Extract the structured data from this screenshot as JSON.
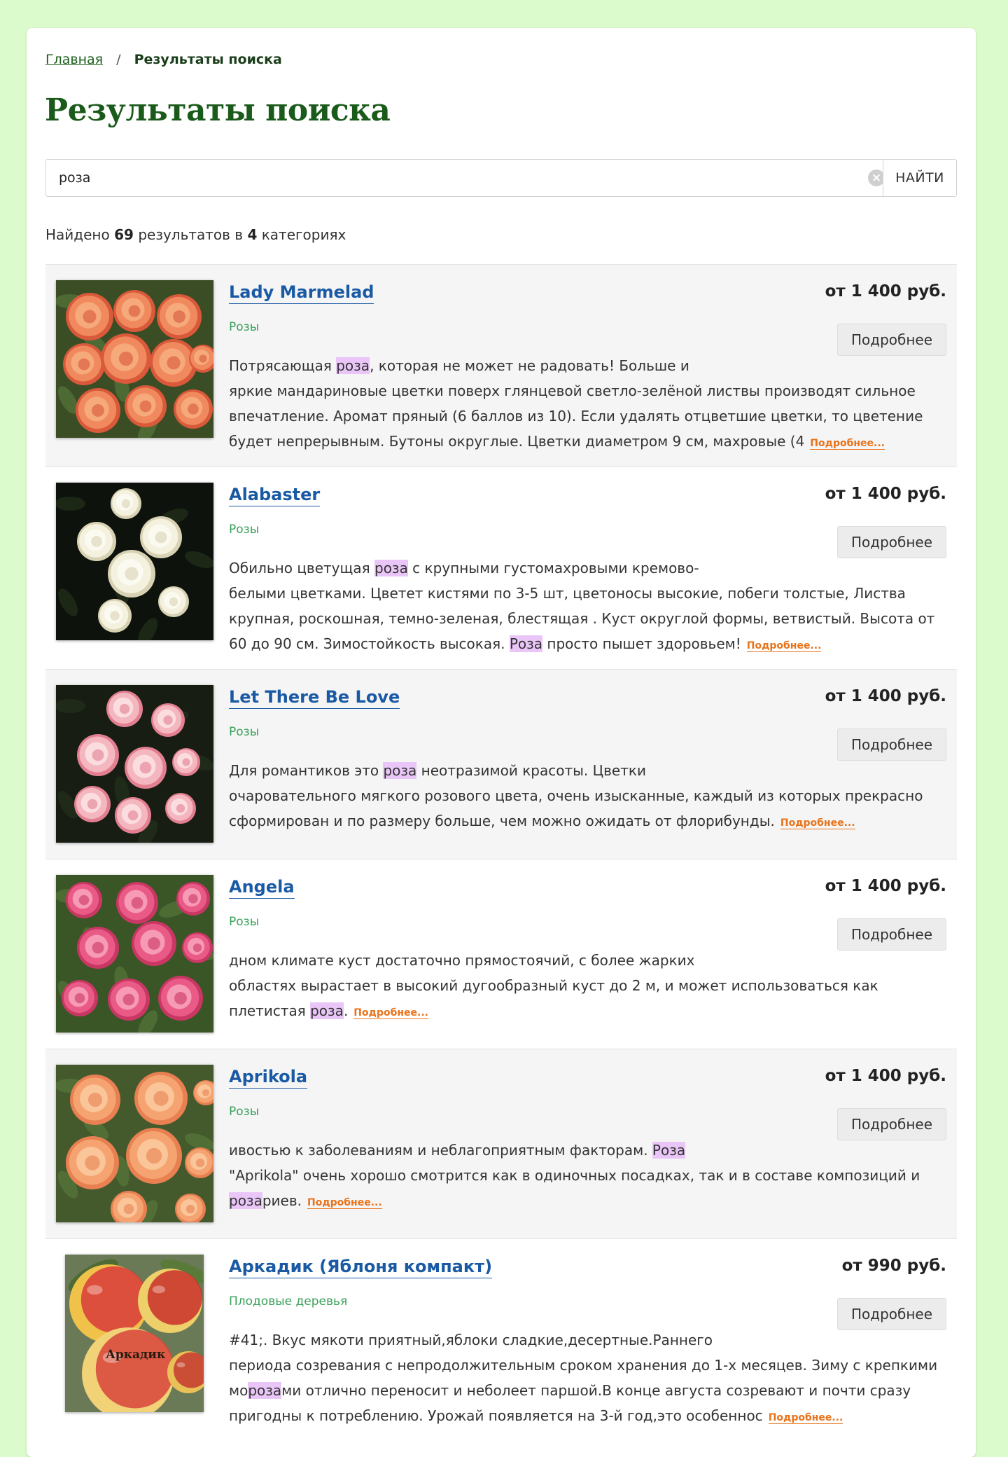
{
  "breadcrumb": {
    "home": "Главная",
    "separator": "/",
    "current": "Результаты поиска"
  },
  "page_title": "Результаты поиска",
  "search": {
    "value": "роза",
    "clear_icon": "×",
    "button": "НАЙТИ"
  },
  "summary": {
    "prefix": "Найдено",
    "count": "69",
    "middle": "результатов в",
    "categories": "4",
    "suffix": "категориях"
  },
  "more_button": "Подробнее",
  "more_link": "Подробнее...",
  "items": [
    {
      "name": "Lady Marmelad",
      "category": "Розы",
      "price": "от 1 400 руб.",
      "desc": [
        {
          "t": "Потрясающая "
        },
        {
          "t": "роза",
          "h": true
        },
        {
          "t": ", которая не может не радовать! Больше и"
        },
        {
          "br": true
        },
        {
          "t": "яркие мандариновые цветки поверх глянцевой светло-зелёной листвы производят сильное впечатление. Аромат пряный (6 баллов из 10). Если удалять отцветшие цветки, то цветение будет непрерывным. Бутоны округлые. Цветки диаметром 9 см, махровые (4"
        }
      ]
    },
    {
      "name": "Alabaster",
      "category": "Розы",
      "price": "от 1 400 руб.",
      "desc": [
        {
          "t": "Обильно цветущая "
        },
        {
          "t": "роза",
          "h": true
        },
        {
          "t": " с крупными густомахровыми кремово-"
        },
        {
          "br": true
        },
        {
          "t": "белыми цветками. Цветет кистями по 3-5 шт, цветоносы высокие, побеги толстые, Листва крупная, роскошная, темно-зеленая, блестящая . Куст округлой формы, ветвистый. Высота от 60 до 90 см. Зимостойкость высокая. "
        },
        {
          "t": "Роза",
          "h": true
        },
        {
          "t": " просто пышет здоровьем!"
        }
      ]
    },
    {
      "name": "Let There Be Love",
      "category": "Розы",
      "price": "от 1 400 руб.",
      "desc": [
        {
          "t": "Для романтиков это "
        },
        {
          "t": "роза",
          "h": true
        },
        {
          "t": " неотразимой красоты. Цветки"
        },
        {
          "br": true
        },
        {
          "t": "очаровательного мягкого розового цвета, очень изысканные, каждый из которых прекрасно сформирован и по размеру больше, чем можно ожидать от флорибунды."
        }
      ]
    },
    {
      "name": "Angela",
      "category": "Розы",
      "price": "от 1 400 руб.",
      "desc": [
        {
          "t": "дном климате куст достаточно прямостоячий, с более жарких"
        },
        {
          "br": true
        },
        {
          "t": "областях вырастает в высокий дугообразный куст до 2 м, и может использоваться как плетистая "
        },
        {
          "t": "роза",
          "h": true
        },
        {
          "t": "."
        }
      ]
    },
    {
      "name": "Aprikola",
      "category": "Розы",
      "price": "от 1 400 руб.",
      "desc": [
        {
          "t": "ивостью к заболеваниям и неблагоприятным факторам. "
        },
        {
          "t": "Роза",
          "h": true
        },
        {
          "br": true
        },
        {
          "t": "\"Aprikola\" очень хорошо смотрится как в одиночных посадках, так и в составе композиций и "
        },
        {
          "t": "роза",
          "h": true
        },
        {
          "t": "риев."
        }
      ]
    },
    {
      "name": "Аркадик (Яблоня компакт)",
      "category": "Плодовые деревья",
      "price": "от 990 руб.",
      "image_label": "Аркадик",
      "desc": [
        {
          "t": "#41;. Вкус мякоти приятный,яблоки сладкие,десертные.Раннего"
        },
        {
          "br": true
        },
        {
          "t": "периода созревания с непродолжительным сроком хранения до 1-х месяцев. Зиму с крепкими мо"
        },
        {
          "t": "роза",
          "h": true
        },
        {
          "t": "ми отлично переносит и неболеет паршой.В конце августа созревают и почти сразу пригодны к потреблению. Урожай появляется на 3-й год,это особеннос"
        }
      ]
    }
  ]
}
